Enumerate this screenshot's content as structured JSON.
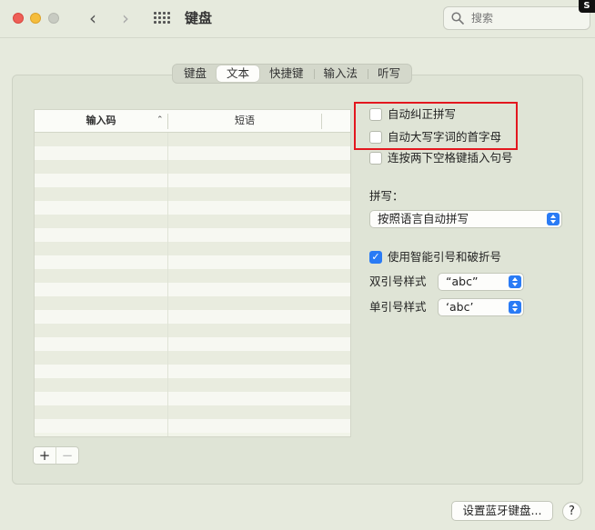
{
  "window": {
    "title": "键盘",
    "search_placeholder": "搜索"
  },
  "tabs": [
    {
      "label": "键盘",
      "active": false
    },
    {
      "label": "文本",
      "active": true
    },
    {
      "label": "快捷键",
      "active": false
    },
    {
      "label": "输入法",
      "active": false
    },
    {
      "label": "听写",
      "active": false
    }
  ],
  "table": {
    "col_code": "输入码",
    "col_phrase": "短语"
  },
  "options": {
    "auto_correct": {
      "label": "自动纠正拼写",
      "checked": false
    },
    "auto_capitalize": {
      "label": "自动大写字词的首字母",
      "checked": false
    },
    "double_space_period": {
      "label": "连按两下空格键插入句号",
      "checked": false
    }
  },
  "spelling": {
    "label": "拼写：",
    "value": "按照语言自动拼写"
  },
  "smart_quotes": {
    "label": "使用智能引号和破折号",
    "checked": true,
    "double_label": "双引号样式",
    "double_value": "“abc”",
    "single_label": "单引号样式",
    "single_value": "‘abc’"
  },
  "buttons": {
    "add": "+",
    "remove": "−",
    "bluetooth": "设置蓝牙键盘...",
    "help": "?"
  },
  "colors": {
    "accent": "#2a7bf5",
    "highlight_box": "#e3171f"
  }
}
